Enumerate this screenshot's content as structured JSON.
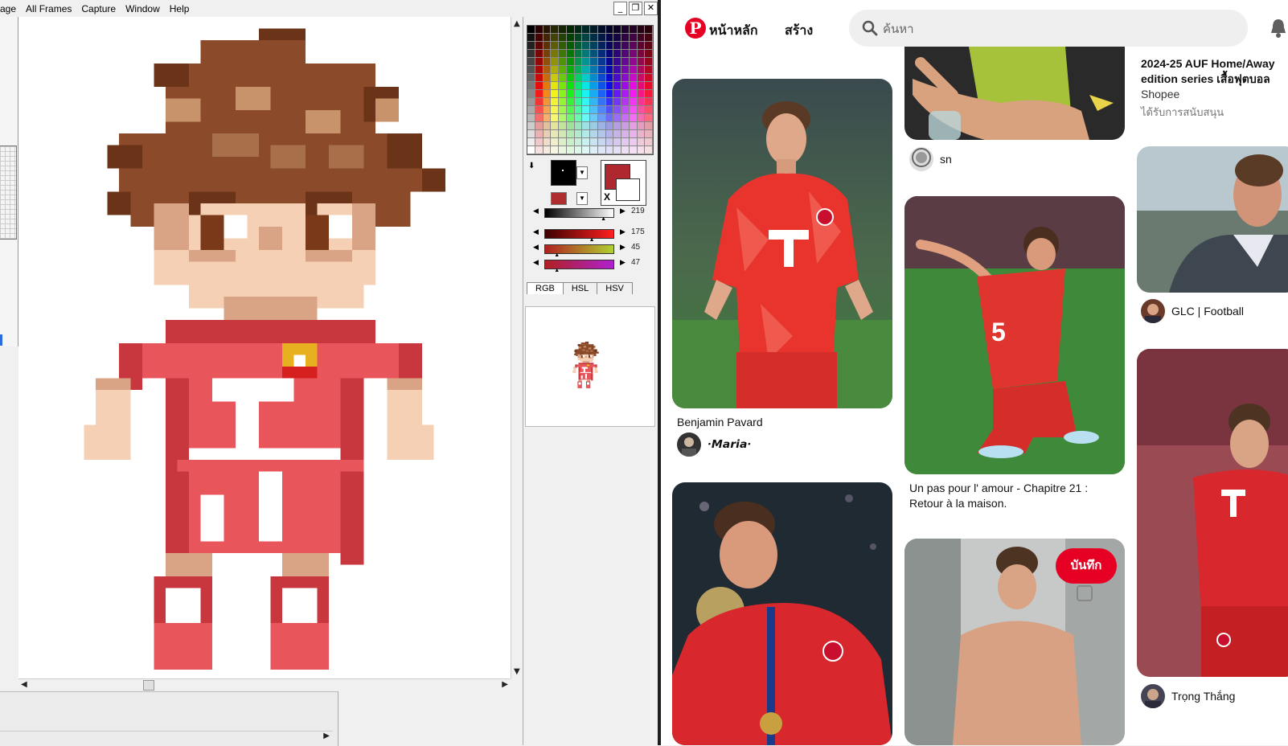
{
  "editor": {
    "menu": [
      "age",
      "All Frames",
      "Capture",
      "Window",
      "Help"
    ],
    "window_controls": [
      "_",
      "❐",
      "✕"
    ],
    "colors": {
      "primary": "#000000",
      "secondary": "#b0282f",
      "preview_swatch": "#b02d2f"
    },
    "sliders": [
      {
        "value": "219",
        "fill": "linear-gradient(90deg,#000,#fff)",
        "pos": 0.86
      },
      {
        "value": "175",
        "fill": "linear-gradient(90deg,#3d0000,#ff2020)",
        "pos": 0.69
      },
      {
        "value": "45",
        "fill": "linear-gradient(90deg,#b02020,#b0d030)",
        "pos": 0.18
      },
      {
        "value": "47",
        "fill": "linear-gradient(90deg,#b02020,#b020d0)",
        "pos": 0.18
      }
    ],
    "tabs": [
      "RGB",
      "HSL",
      "HSV"
    ],
    "active_tab": "RGB"
  },
  "pinterest": {
    "nav": {
      "home": "หน้าหลัก",
      "create": "สร้าง"
    },
    "search": {
      "placeholder": "ค้นหา"
    },
    "pins": [
      {
        "title": "Benjamin Pavard",
        "author": "·𝙈𝙖𝙧𝙞𝙖·"
      },
      {
        "title": "",
        "author": "sn"
      },
      {
        "title": "Un pas pour l' amour - Chapitre 21 : Retour à la maison.",
        "author": ""
      },
      {
        "title": "2024-25 AUF Home/Away edition series เสื้อฟุตบอล",
        "author": "Shopee",
        "sponsored": "ได้รับการสนับสนุน"
      },
      {
        "title": "",
        "author": "GLC | Football"
      },
      {
        "title": "",
        "author": "Trọng Thắng"
      }
    ],
    "save_label": "บันทึก",
    "accent": "#e60023"
  }
}
